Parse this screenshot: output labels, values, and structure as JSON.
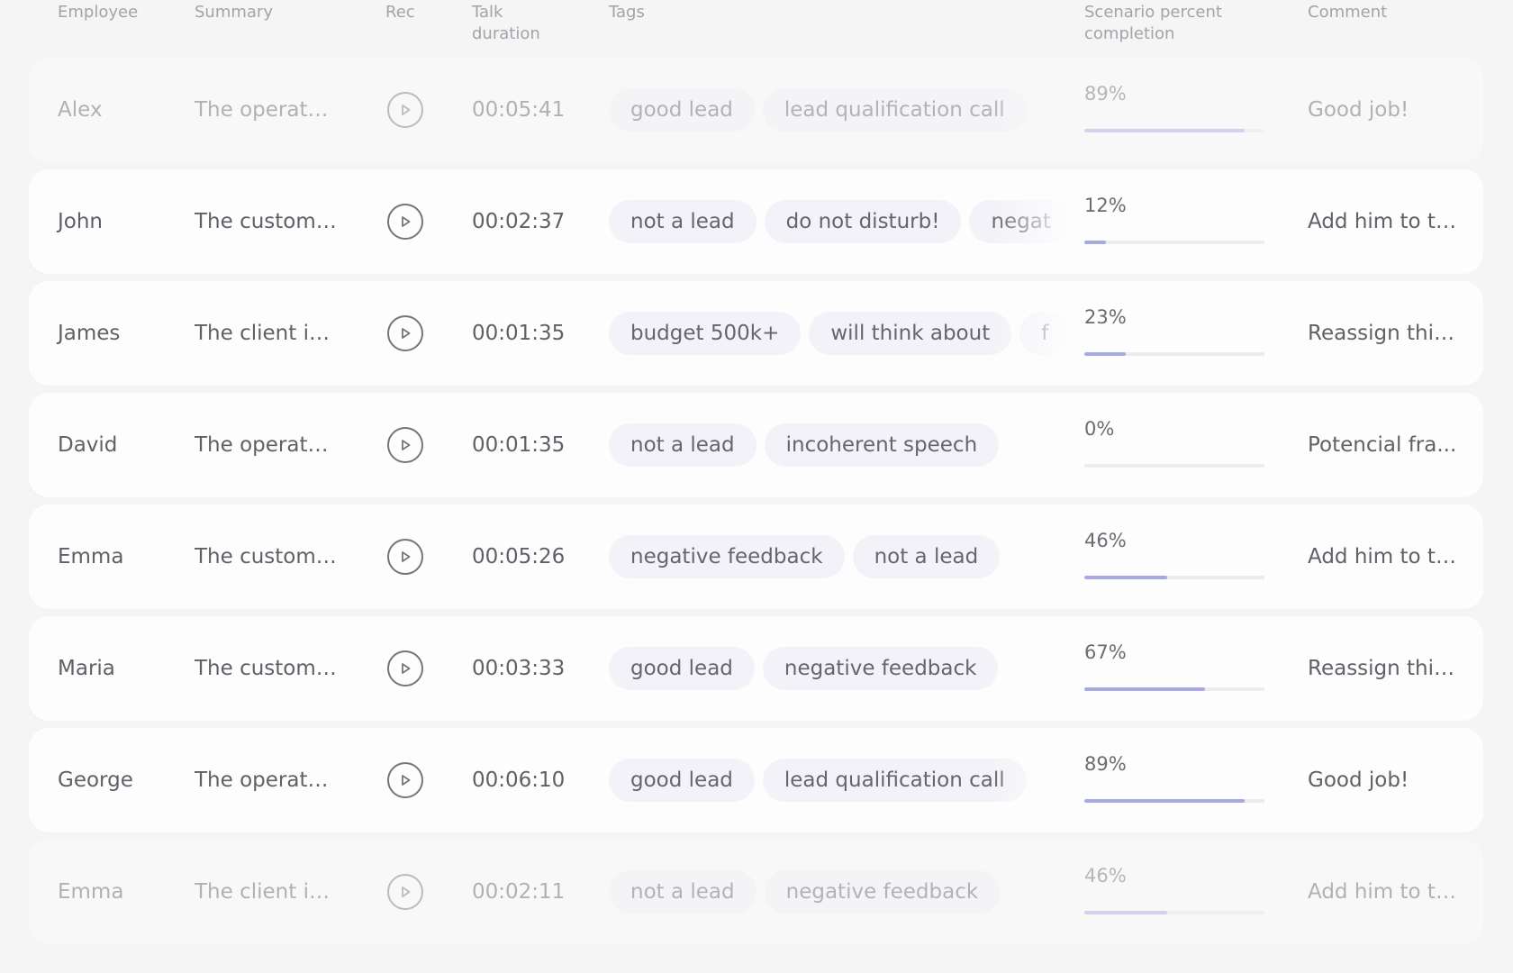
{
  "header": {
    "employee": "Employee",
    "summary": "Summary",
    "rec": "Rec",
    "talk_duration_1": "Talk",
    "talk_duration_2": "duration",
    "tags": "Tags",
    "scenario_1": "Scenario percent",
    "scenario_2": "completion",
    "comment": "Comment"
  },
  "colors": {
    "progress_fill": "#a8a8e6",
    "tag_bg": "#f3f2f8",
    "row_bg": "#fdfdfd",
    "page_bg": "#f5f5f6"
  },
  "rows": [
    {
      "employee": "Alex",
      "summary": "The operator...",
      "rec_icon": "play-icon",
      "duration": "00:05:41",
      "tags": [
        "good lead",
        "lead qualification call"
      ],
      "percent_label": "89%",
      "percent": 0.89,
      "comment": "Good job!",
      "faded": true
    },
    {
      "employee": "John",
      "summary": "The custome...",
      "rec_icon": "play-icon",
      "duration": "00:02:37",
      "tags": [
        "not a lead",
        "do not disturb!",
        "negat"
      ],
      "percent_label": "12%",
      "percent": 0.12,
      "comment": "Add him to th...",
      "faded": false
    },
    {
      "employee": "James",
      "summary": "The client is...",
      "rec_icon": "play-icon",
      "duration": "00:01:35",
      "tags": [
        "budget 500k+",
        "will think about",
        "f"
      ],
      "percent_label": "23%",
      "percent": 0.23,
      "comment": "Reassign this...",
      "faded": false
    },
    {
      "employee": "David",
      "summary": "The operator...",
      "rec_icon": "play-icon",
      "duration": "00:01:35",
      "tags": [
        "not a lead",
        "incoherent speech"
      ],
      "percent_label": "0%",
      "percent": 0.0,
      "comment": "Potencial fra...",
      "faded": false
    },
    {
      "employee": "Emma",
      "summary": "The custome...",
      "rec_icon": "play-icon",
      "duration": "00:05:26",
      "tags": [
        "negative feedback",
        "not a lead"
      ],
      "percent_label": "46%",
      "percent": 0.46,
      "comment": "Add him to th...",
      "faded": false
    },
    {
      "employee": "Maria",
      "summary": "The custome...",
      "rec_icon": "play-icon",
      "duration": "00:03:33",
      "tags": [
        "good lead",
        "negative feedback"
      ],
      "percent_label": "67%",
      "percent": 0.67,
      "comment": "Reassign this...",
      "faded": false
    },
    {
      "employee": "George",
      "summary": "The operator...",
      "rec_icon": "play-icon",
      "duration": "00:06:10",
      "tags": [
        "good lead",
        "lead qualification call"
      ],
      "percent_label": "89%",
      "percent": 0.89,
      "comment": "Good job!",
      "faded": false
    },
    {
      "employee": "Emma",
      "summary": "The client is...",
      "rec_icon": "play-icon",
      "duration": "00:02:11",
      "tags": [
        "not a lead",
        "negative feedback"
      ],
      "percent_label": "46%",
      "percent": 0.46,
      "comment": "Add him to th...",
      "faded": true
    }
  ]
}
